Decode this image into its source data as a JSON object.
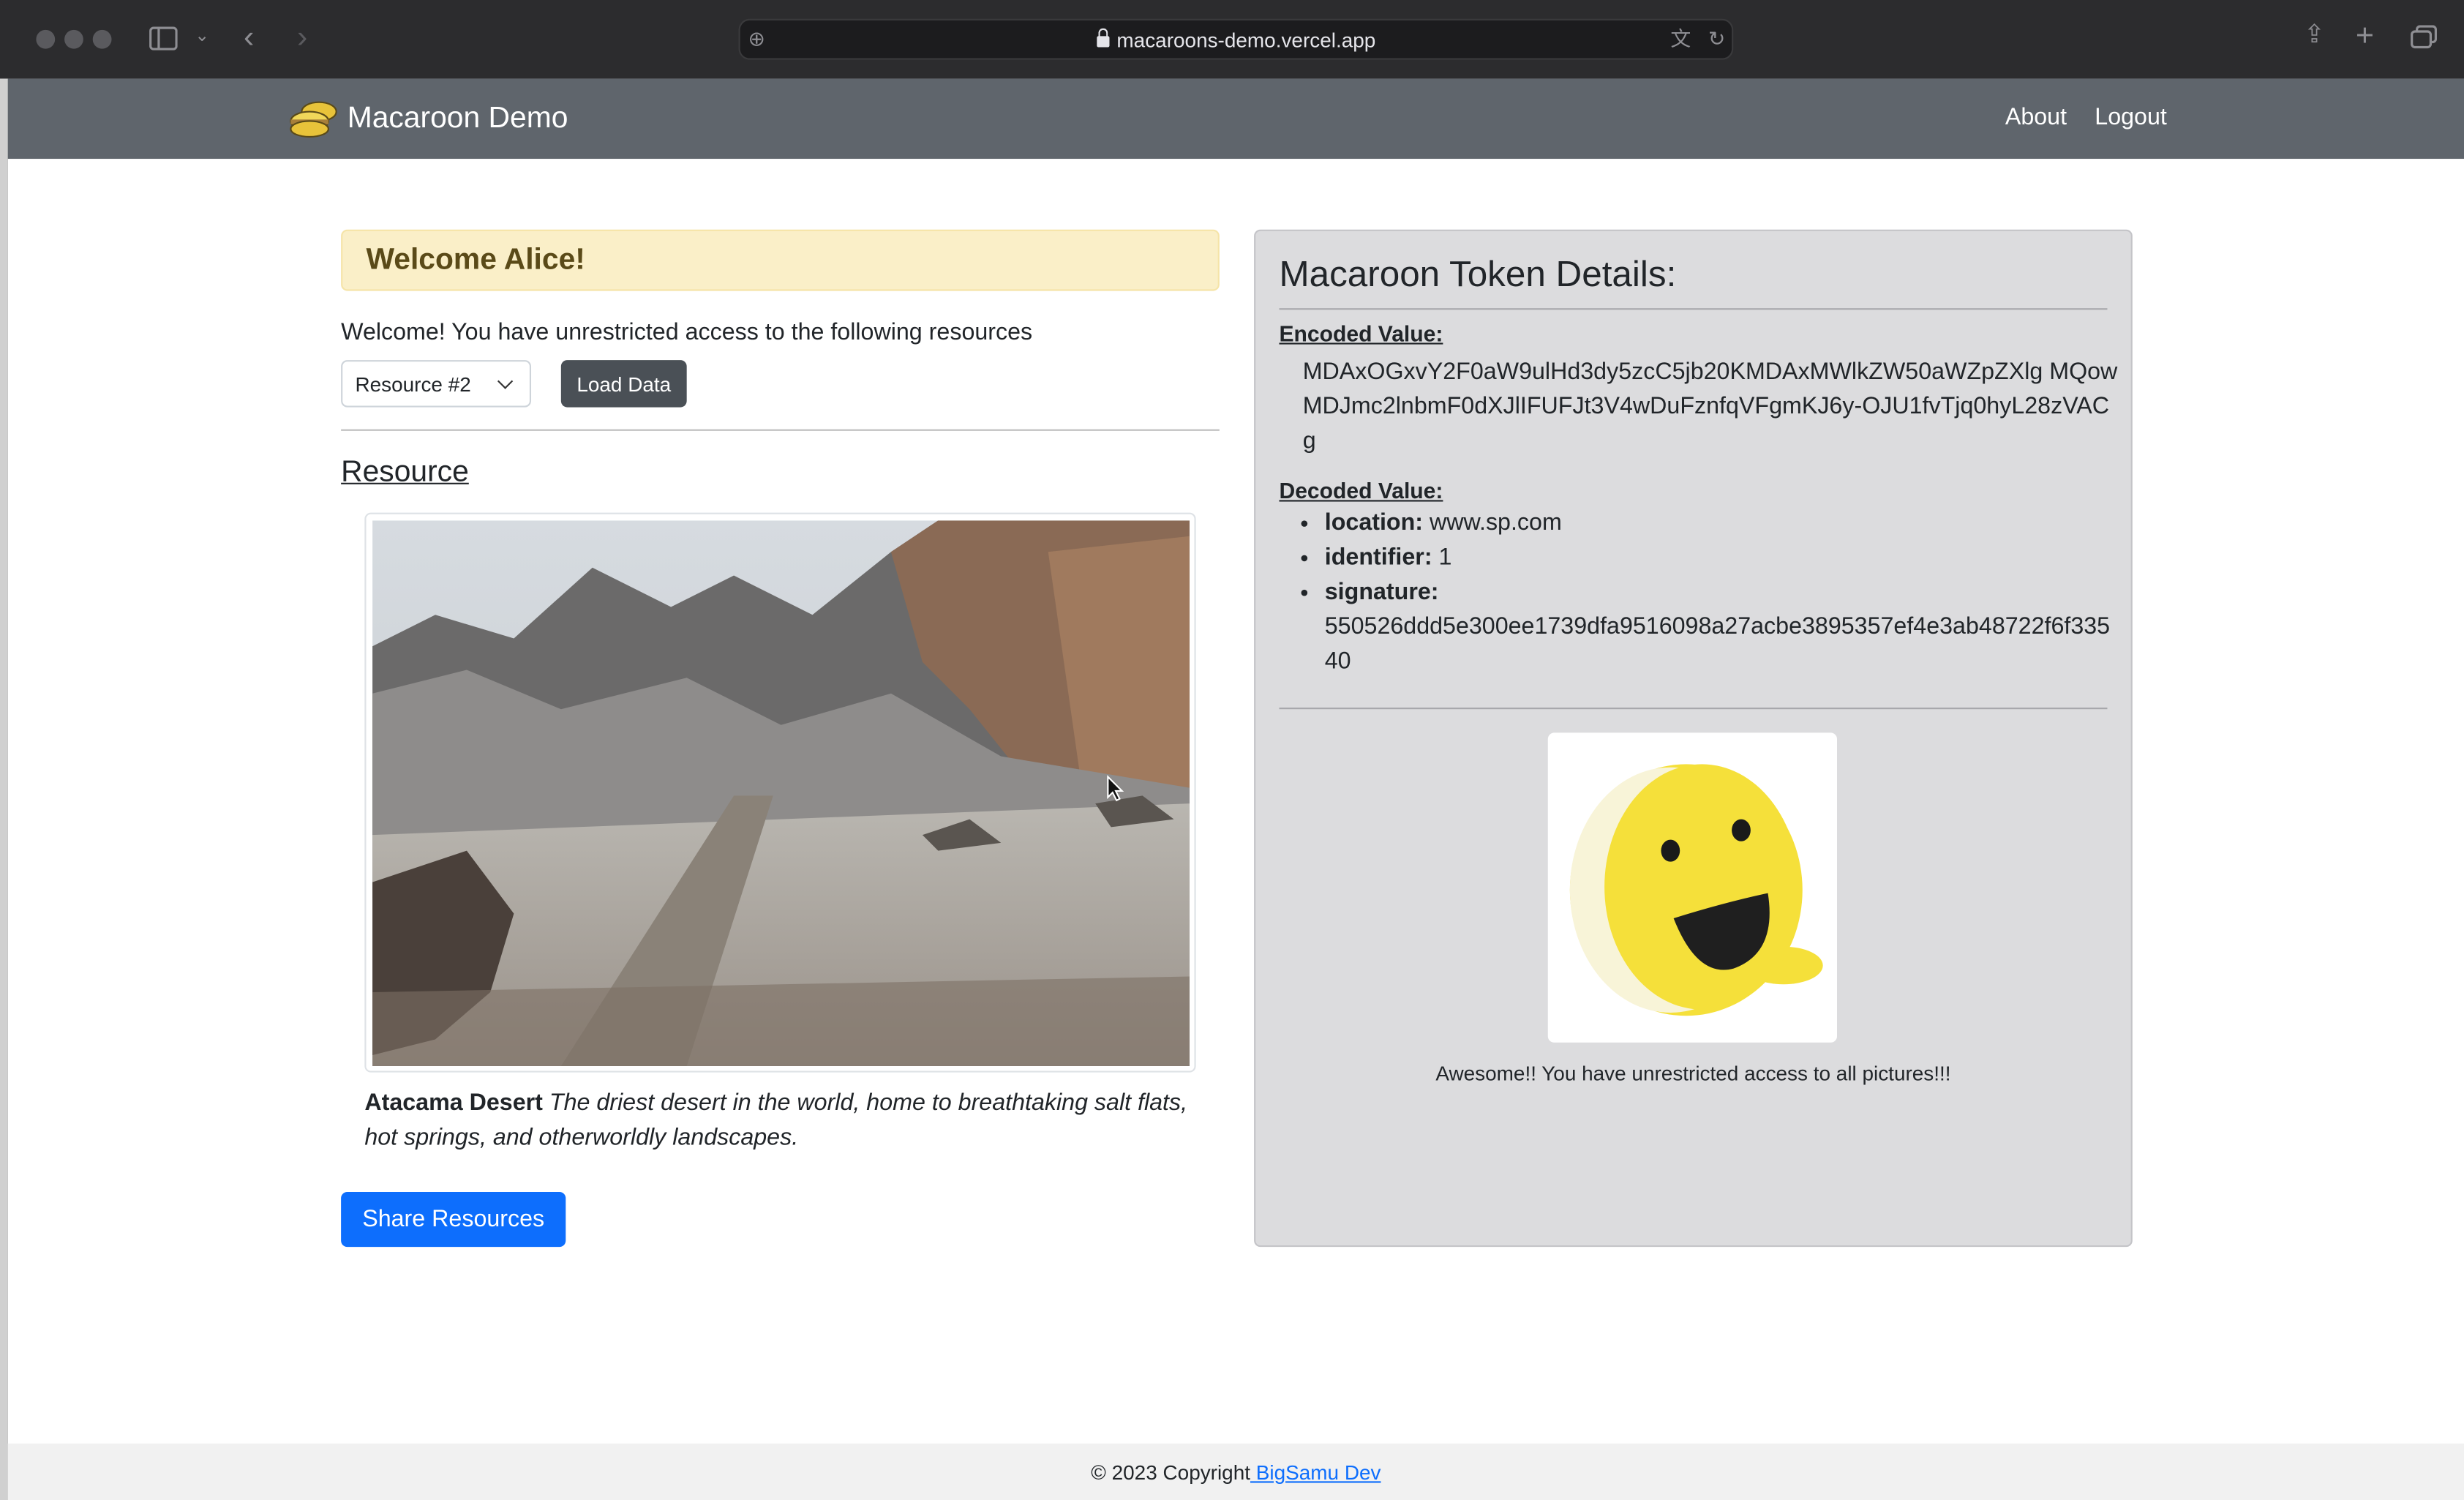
{
  "browser": {
    "url": "macaroons-demo.vercel.app"
  },
  "navbar": {
    "brand": "Macaroon Demo",
    "links": [
      {
        "label": "About"
      },
      {
        "label": "Logout"
      }
    ]
  },
  "left": {
    "welcome_heading": "Welcome Alice!",
    "welcome_text": "Welcome! You have unrestricted access to the following resources",
    "resource_select": {
      "selected": "Resource #2"
    },
    "load_button": "Load Data",
    "resource_title": "Resource",
    "caption_title": "Atacama Desert",
    "caption_body": "The driest desert in the world, home to breathtaking salt flats, hot springs, and otherworldly landscapes.",
    "share_button": "Share Resources"
  },
  "panel": {
    "title": "Macaroon Token Details:",
    "encoded_label": "Encoded Value:",
    "encoded_value": "MDAxOGxvY2F0aW9ulHd3dy5zcC5jb20KMDAxMWlkZW50aWZpZXlg MQowMDJmc2lnbmF0dXJlIFUFJt3V4wDuFznfqVFgmKJ6y-OJU1fvTjq0hyL28zVACg",
    "decoded_label": "Decoded Value:",
    "decoded": [
      {
        "key": "location:",
        "value": " www.sp.com"
      },
      {
        "key": "identifier:",
        "value": " 1"
      },
      {
        "key": "signature:",
        "value": "550526ddd5e300ee1739dfa9516098a27acbe3895357ef4e3ab48722f6f33540"
      }
    ],
    "message": "Awesome!! You have unrestricted access to all pictures!!!"
  },
  "footer": {
    "text": "© 2023 Copyright",
    "link": " BigSamu Dev"
  },
  "colors": {
    "navbar": "#5f656c",
    "primary": "#0d6efd",
    "alert_bg": "#faefc8",
    "panel_bg": "#dcdcde",
    "mascot_yellow": "#f5e03a"
  }
}
